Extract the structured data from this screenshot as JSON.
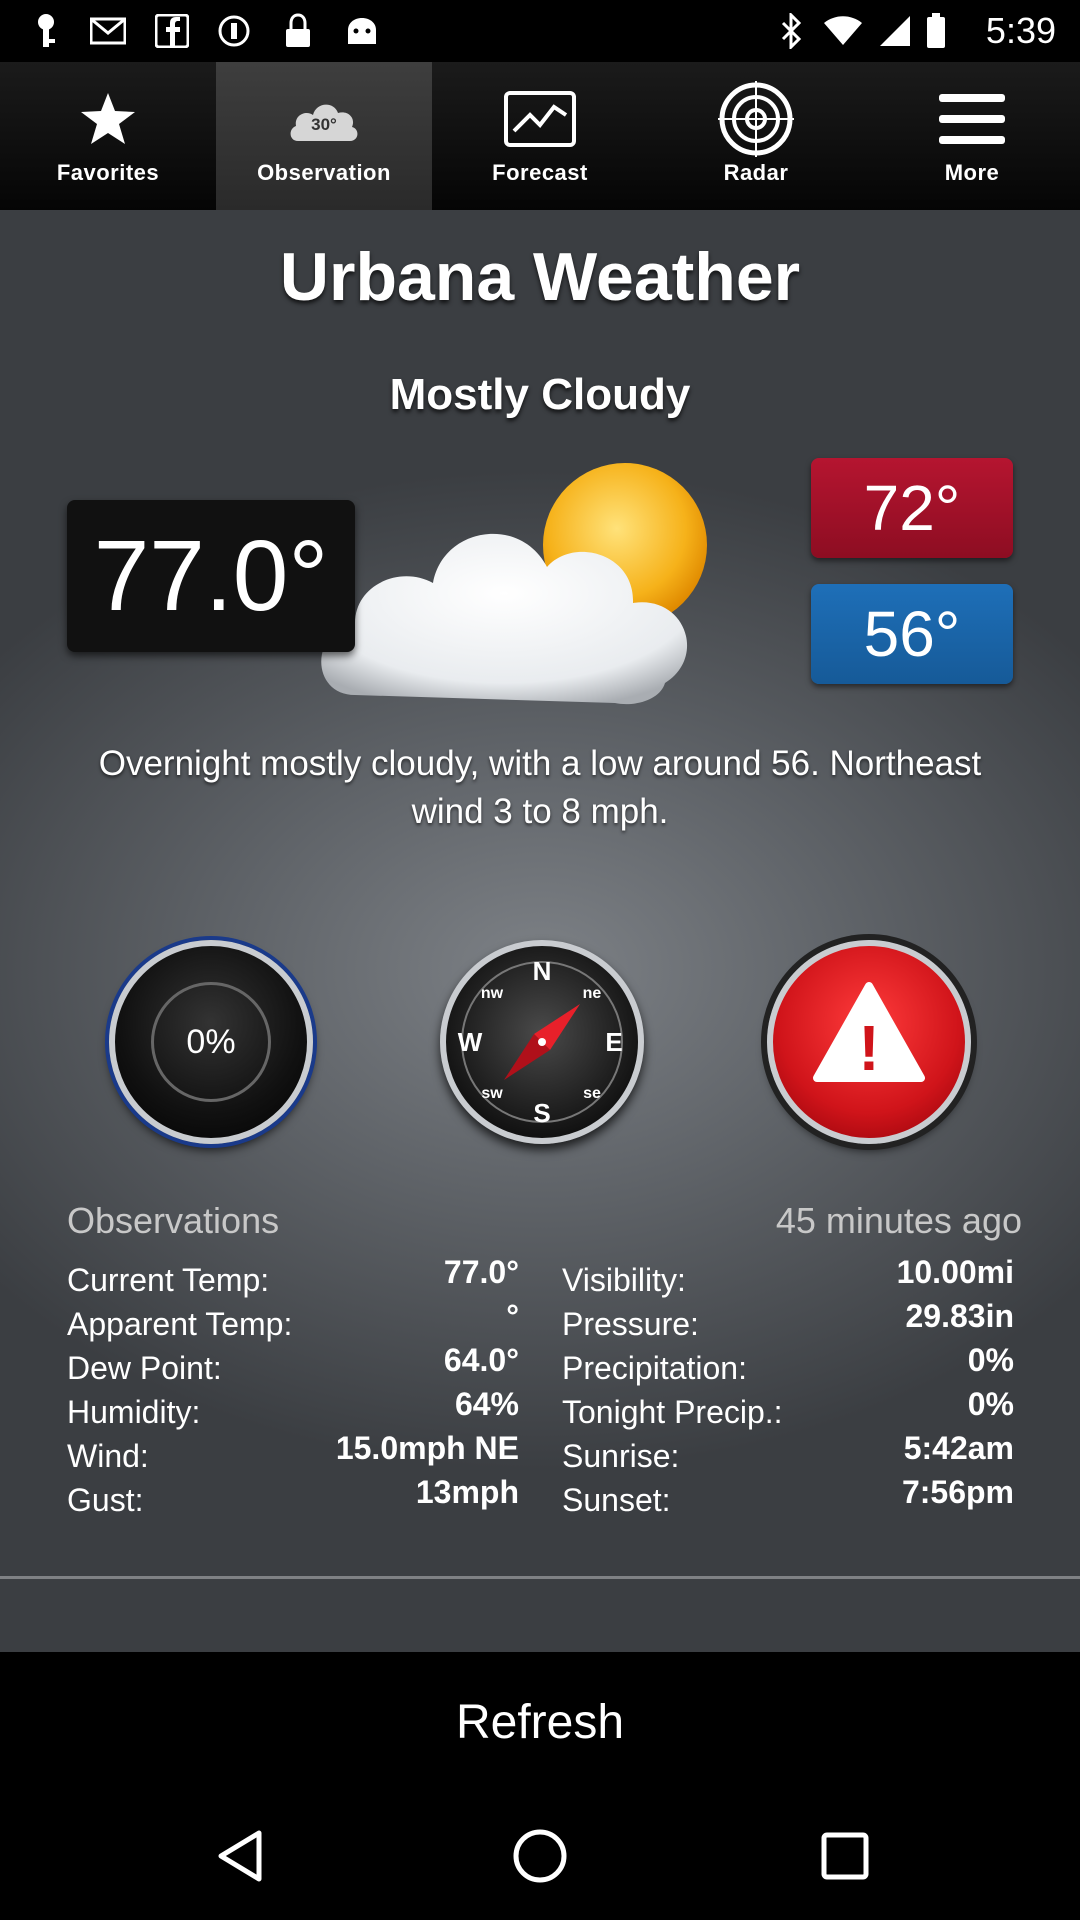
{
  "status_bar": {
    "time": "5:39",
    "icons": [
      "key-icon",
      "mail-icon",
      "facebook-icon",
      "sync-icon",
      "lock-icon",
      "android-icon",
      "bluetooth-icon",
      "wifi-icon",
      "signal-icon",
      "battery-icon"
    ]
  },
  "tabs": [
    {
      "label": "Favorites",
      "icon": "star-icon"
    },
    {
      "label": "Observation",
      "icon": "cloud-30-icon",
      "icon_text": "30°",
      "active": true
    },
    {
      "label": "Forecast",
      "icon": "chart-icon"
    },
    {
      "label": "Radar",
      "icon": "radar-icon"
    },
    {
      "label": "More",
      "icon": "menu-icon"
    }
  ],
  "main": {
    "title": "Urbana Weather",
    "condition": "Mostly Cloudy",
    "current_temp": "77.0°",
    "high_temp": "72°",
    "low_temp": "56°",
    "forecast_text": "Overnight mostly cloudy, with a low around 56. Northeast wind 3 to 8 mph.",
    "precip_dial": "0%",
    "compass_letters": {
      "n": "N",
      "e": "E",
      "s": "S",
      "w": "W",
      "ne": "ne",
      "nw": "nw",
      "se": "se",
      "sw": "sw"
    },
    "alert_symbol": "!"
  },
  "observations": {
    "title": "Observations",
    "updated": "45 minutes ago",
    "left": [
      {
        "label": "Current Temp:",
        "value": "77.0°"
      },
      {
        "label": "Apparent Temp:",
        "value": "°"
      },
      {
        "label": "Dew Point:",
        "value": "64.0°"
      },
      {
        "label": "Humidity:",
        "value": "64%"
      },
      {
        "label": "Wind:",
        "value": "15.0mph NE"
      },
      {
        "label": "Gust:",
        "value": "13mph"
      }
    ],
    "right": [
      {
        "label": "Visibility:",
        "value": "10.00mi"
      },
      {
        "label": "Pressure:",
        "value": "29.83in"
      },
      {
        "label": "Precipitation:",
        "value": "0%"
      },
      {
        "label": "Tonight Precip.:",
        "value": "0%"
      },
      {
        "label": "Sunrise:",
        "value": "5:42am"
      },
      {
        "label": "Sunset:",
        "value": "7:56pm"
      }
    ]
  },
  "refresh_label": "Refresh",
  "colors": {
    "high": "#b51530",
    "low": "#1e6fb8",
    "alert": "#d0141a"
  }
}
